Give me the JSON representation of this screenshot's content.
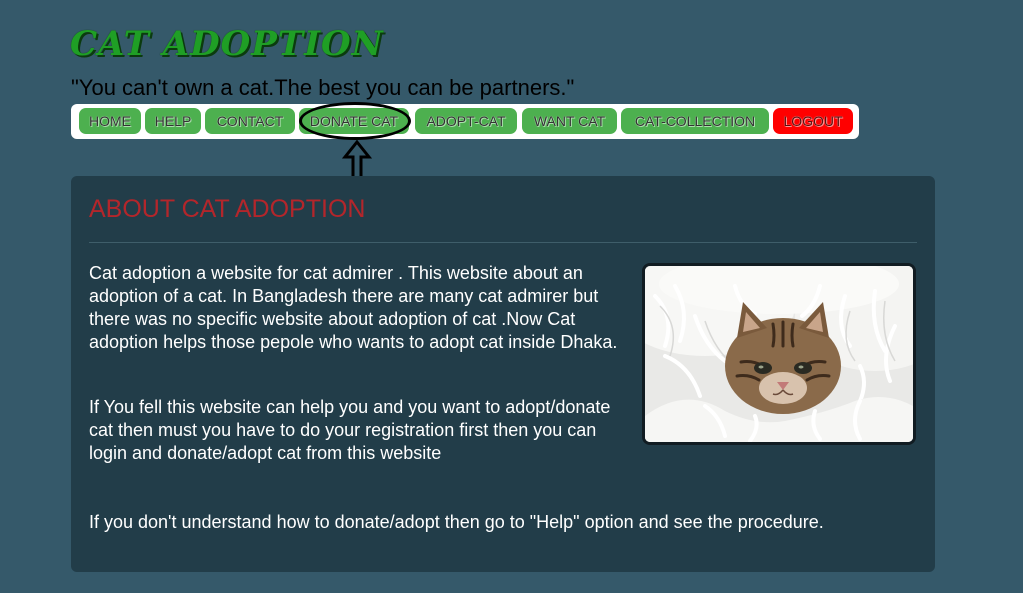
{
  "header": {
    "site_title": "CAT ADOPTION",
    "tagline": "\"You can't own a cat.The best you can be partners.\""
  },
  "nav": {
    "items": [
      {
        "label": "HOME"
      },
      {
        "label": "HELP"
      },
      {
        "label": "CONTACT"
      },
      {
        "label": "DONATE CAT"
      },
      {
        "label": "ADOPT-CAT"
      },
      {
        "label": "WANT CAT"
      },
      {
        "label": "CAT-COLLECTION"
      },
      {
        "label": "LOGOUT"
      }
    ]
  },
  "annotation": {
    "highlighted_item": "DONATE CAT",
    "marker_shape": "ellipse-with-up-arrow",
    "marker_color": "#000000"
  },
  "about": {
    "heading": "ABOUT CAT ADOPTION",
    "paragraph_1": "Cat adoption a website for cat admirer . This website about an adoption of a cat. In Bangladesh there are many cat admirer but there was no specific website about adoption of cat .Now Cat adoption helps those pepole who wants to adopt cat inside Dhaka.",
    "paragraph_2": "If You fell this website can help you and you want to adopt/donate cat then must you have to do your registration first then you can login and donate/adopt cat from this website",
    "paragraph_3": "If you don't understand how to donate/adopt then go to \"Help\" option and see the procedure.",
    "image": "kitten-in-white-blanket-photo"
  },
  "colors": {
    "page_background": "#35596a",
    "panel_background": "#223d49",
    "title_green": "#1f9f25",
    "nav_button_green": "#4db04f",
    "logout_red": "#ff0000",
    "heading_red": "#b3262b"
  }
}
